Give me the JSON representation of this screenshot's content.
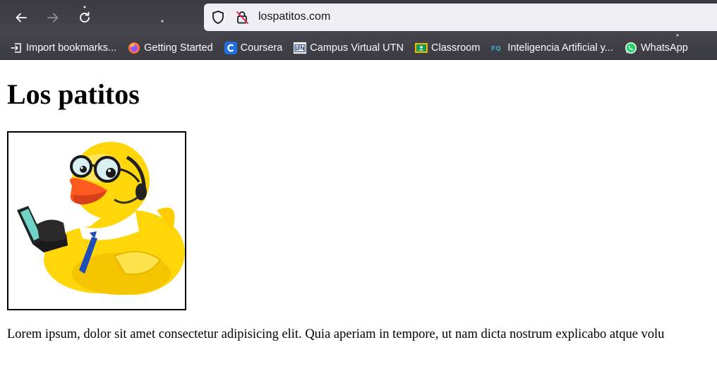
{
  "browser": {
    "url": "lospatitos.com",
    "bookmarks": [
      {
        "label": "Import bookmarks...",
        "icon": "import-icon"
      },
      {
        "label": "Getting Started",
        "icon": "firefox-icon"
      },
      {
        "label": "Coursera",
        "icon": "coursera-icon"
      },
      {
        "label": "Campus Virtual UTN",
        "icon": "utn-icon"
      },
      {
        "label": "Classroom",
        "icon": "classroom-icon"
      },
      {
        "label": "Inteligencia Artificial y...",
        "icon": "fq-icon"
      },
      {
        "label": "WhatsApp",
        "icon": "whatsapp-icon"
      }
    ]
  },
  "page": {
    "title": "Los patitos",
    "image_alt": "rubber duck with glasses, headset and laptop",
    "paragraph": "Lorem ipsum, dolor sit amet consectetur adipisicing elit. Quia aperiam in tempore, ut nam dicta nostrum explicabo atque volu"
  }
}
